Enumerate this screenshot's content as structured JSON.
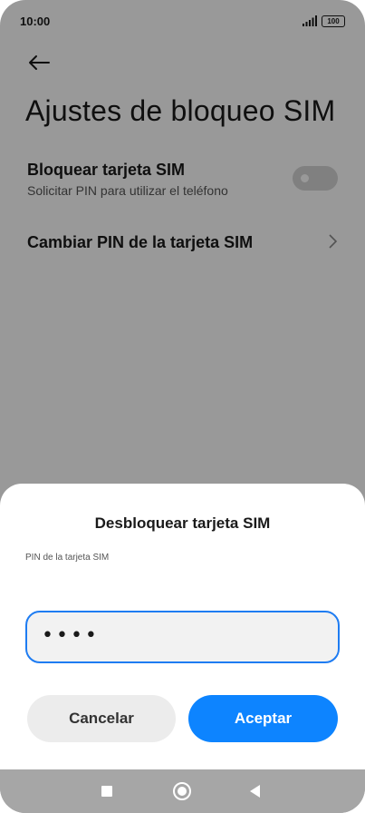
{
  "status_bar": {
    "time": "10:00",
    "battery": "100",
    "icons": [
      "signal-icon",
      "battery-icon"
    ]
  },
  "header": {
    "back_icon": "arrow-left-icon",
    "title": "Ajustes de bloqueo SIM"
  },
  "settings": {
    "lock_sim": {
      "title": "Bloquear tarjeta SIM",
      "subtitle": "Solicitar PIN para utilizar el teléfono",
      "enabled": false
    },
    "change_pin": {
      "title": "Cambiar PIN de la tarjeta SIM",
      "icon": "chevron-right-icon"
    }
  },
  "dialog": {
    "title": "Desbloquear tarjeta SIM",
    "field_label": "PIN de la tarjeta SIM",
    "pin_value": "••••",
    "cancel_label": "Cancelar",
    "accept_label": "Aceptar",
    "colors": {
      "accent": "#0d84ff",
      "input_border": "#1e7cf2"
    }
  },
  "nav_bar": {
    "icons": [
      "recents-square-icon",
      "home-circle-icon",
      "back-triangle-icon"
    ]
  }
}
